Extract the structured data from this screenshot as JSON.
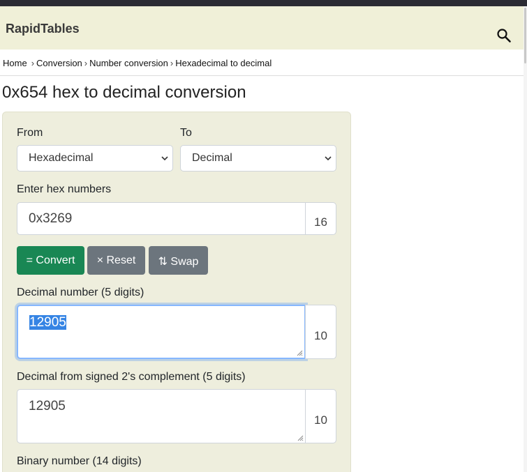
{
  "header": {
    "brand": "RapidTables"
  },
  "breadcrumb": {
    "items": [
      "Home",
      "Conversion",
      "Number conversion",
      "Hexadecimal to decimal"
    ],
    "separator": "›"
  },
  "page": {
    "title": "0x654 hex to decimal conversion"
  },
  "converter": {
    "from_label": "From",
    "to_label": "To",
    "from_value": "Hexadecimal",
    "to_value": "Decimal",
    "input_label": "Enter hex numbers",
    "input_value": "0x3269",
    "input_base": "16",
    "buttons": {
      "convert": "= Convert",
      "reset": "× Reset",
      "swap": "⇅ Swap"
    },
    "decimal_label": "Decimal number (5 digits)",
    "decimal_value": "12905",
    "decimal_base": "10",
    "signed_label": "Decimal from signed 2's complement (5 digits)",
    "signed_value": "12905",
    "signed_base": "10",
    "binary_label": "Binary number (14 digits)"
  },
  "colors": {
    "header_bg": "#f0f0d8",
    "panel_bg": "#eeeedd",
    "convert": "#198754",
    "secondary": "#6c757d",
    "focus": "#86b7fe"
  }
}
